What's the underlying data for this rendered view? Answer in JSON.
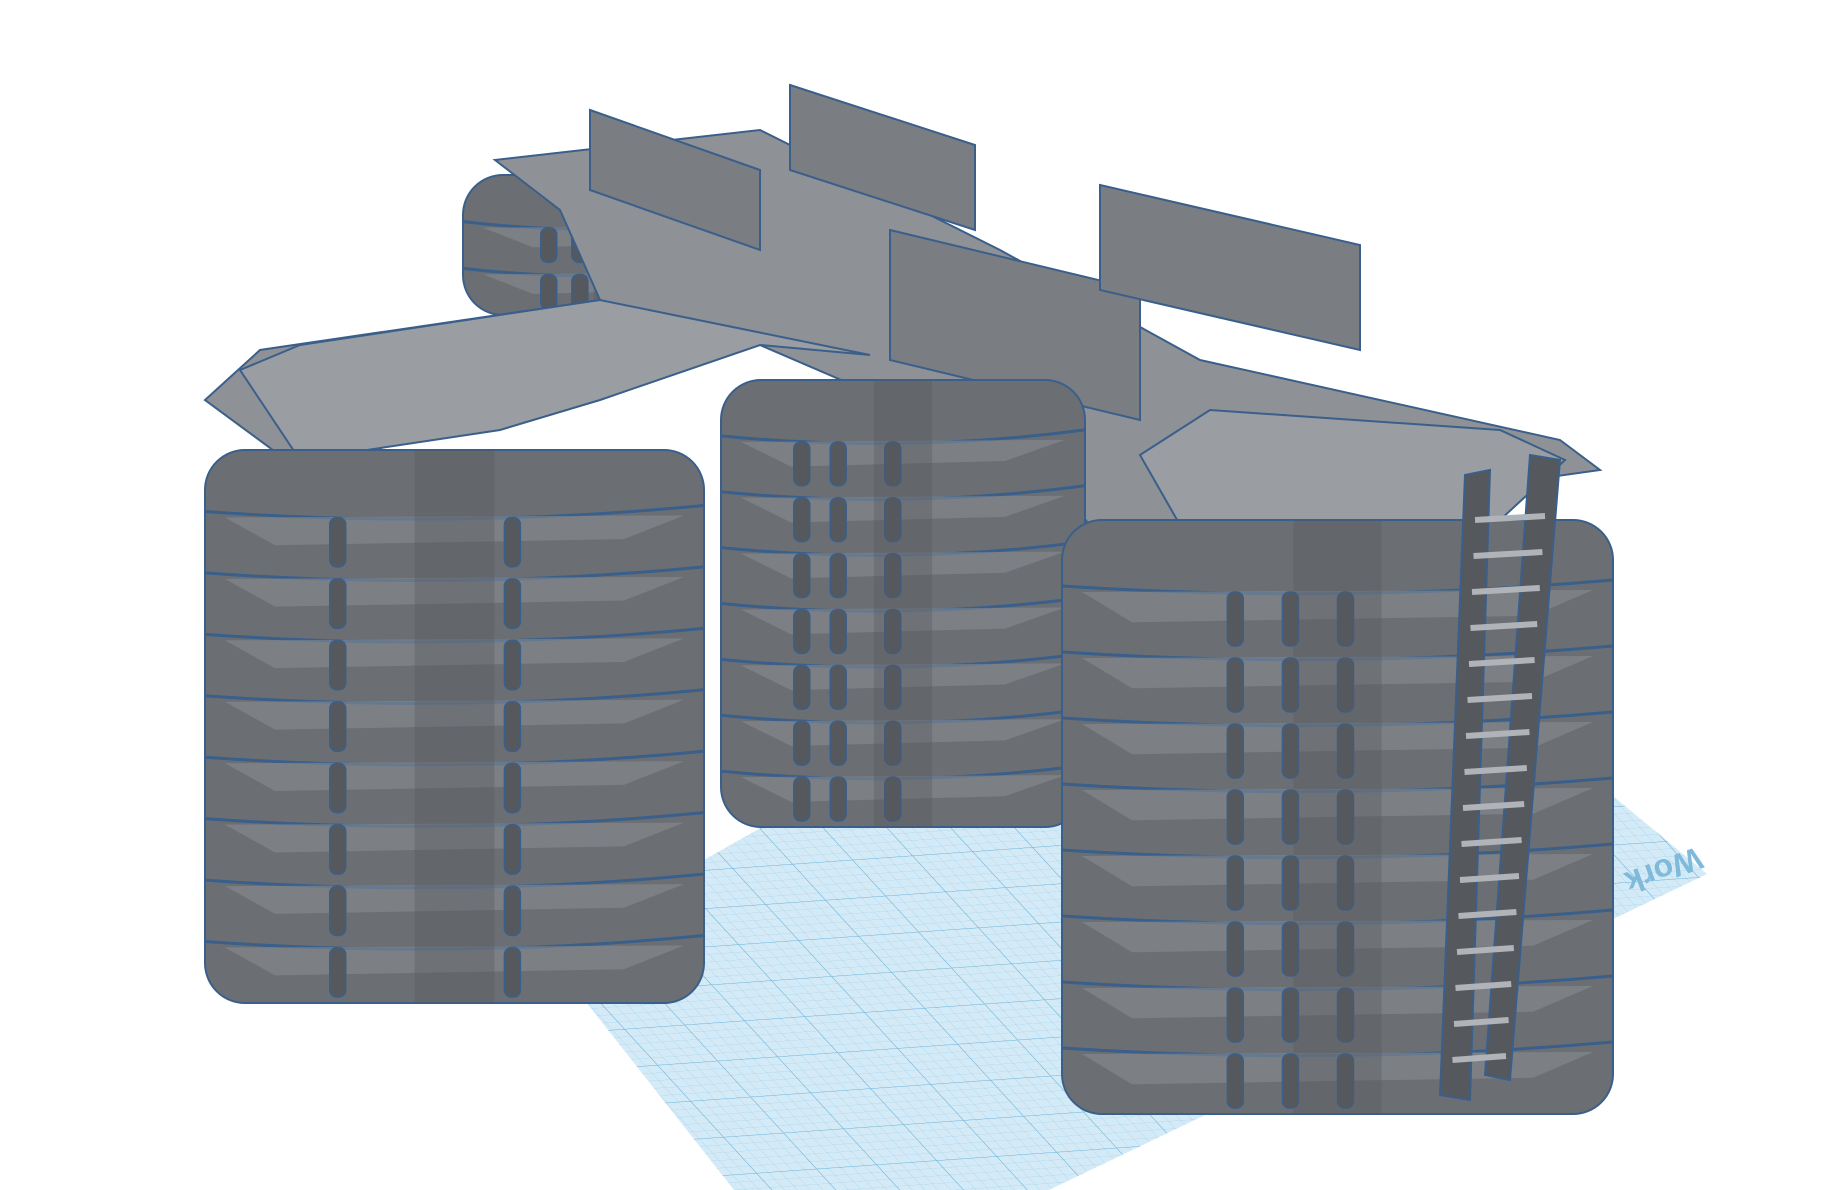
{
  "viewport": {
    "workplane_label": "Work",
    "colors": {
      "background": "#ffffff",
      "workplane": "#cfe8f5",
      "grid": "#8cc6e3",
      "model": "#6b6f74",
      "model_light": "#8a8e93",
      "model_dark": "#55595e",
      "edge": "#3a5f8a"
    }
  }
}
